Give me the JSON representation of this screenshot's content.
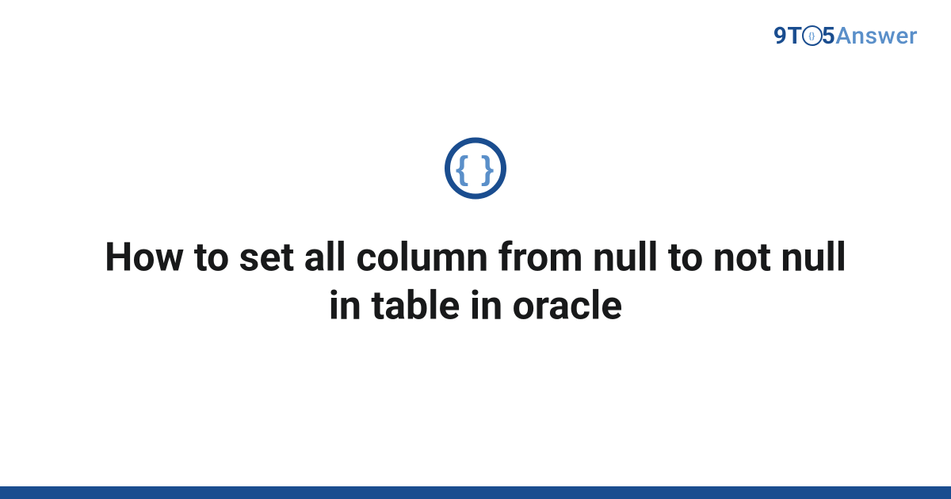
{
  "header": {
    "logo": {
      "part1": "9T",
      "circle_inner": "{}",
      "part2": "5",
      "part3": "Answer"
    }
  },
  "main": {
    "icon_glyph": "{ }",
    "title": "How to set all column from null to not null in table in oracle"
  }
}
